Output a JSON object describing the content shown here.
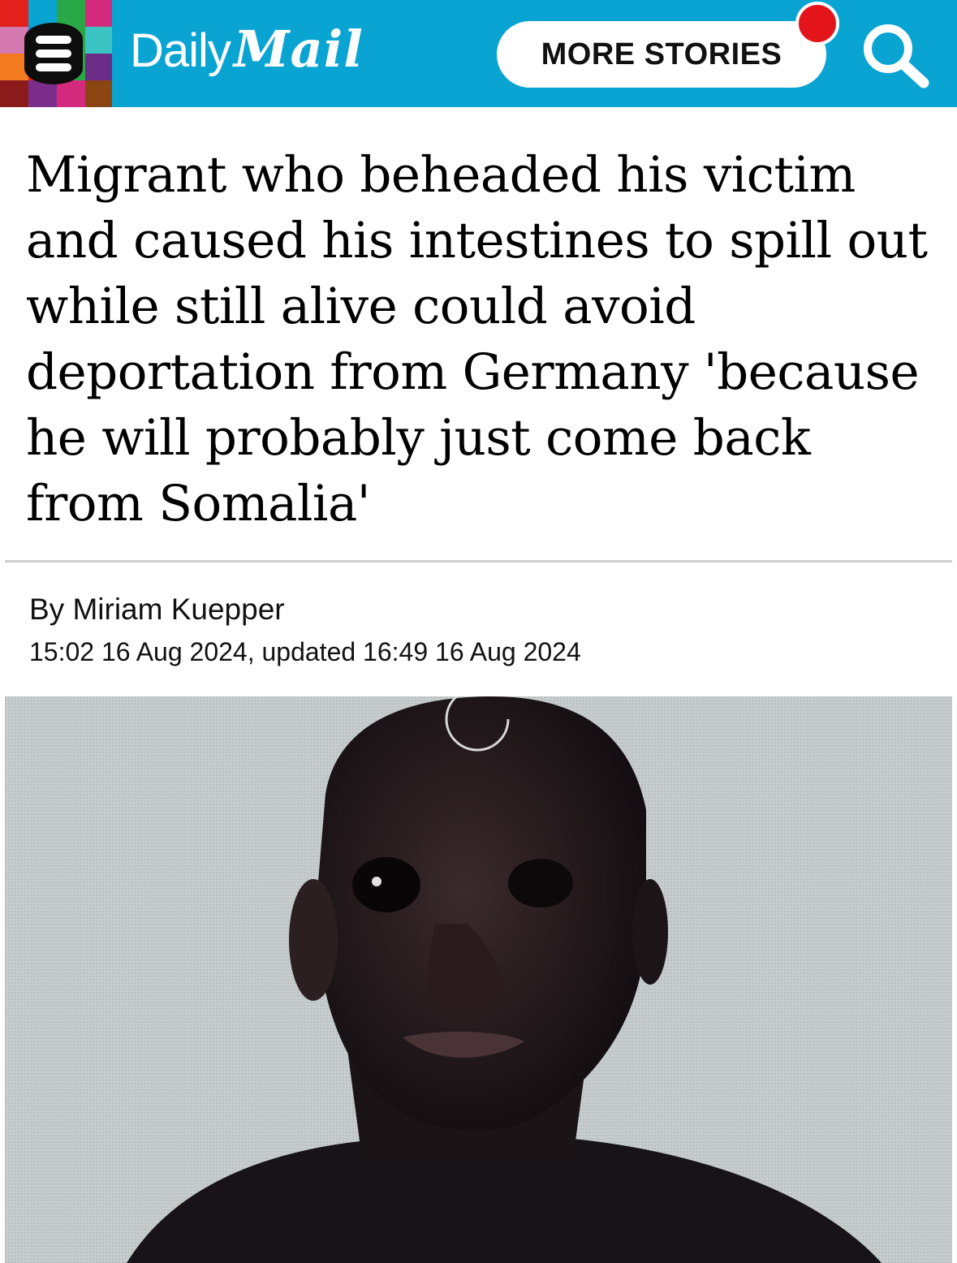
{
  "header": {
    "logo_word1": "Daily",
    "logo_word2": "Mail",
    "more_stories_label": "MORE STORIES",
    "icons": {
      "menu": "hamburger-menu-icon",
      "search": "search-icon",
      "notification": "notification-dot-icon"
    },
    "colors": {
      "bar_background": "#0aa4d2",
      "notification": "#e3151a",
      "menu_tiles": [
        "#e2211c",
        "#2aa847",
        "#d42a7d",
        "#0d8fd1",
        "#f47a20",
        "#7b2d8b",
        "#3cc4c4",
        "#8b1b1b",
        "#a7226e",
        "#6b2c86",
        "#8b4513"
      ]
    }
  },
  "article": {
    "headline": "Migrant who beheaded his victim and caused his intestines to spill out while still alive could avoid deportation from Germany 'because he will probably just come back from Somalia'",
    "byline": "By Miriam Kuepper",
    "dateline": "15:02 16 Aug 2024, updated 16:49 16 Aug 2024"
  },
  "photo": {
    "subject": "man-portrait",
    "background_color": "#c9cdcd"
  }
}
